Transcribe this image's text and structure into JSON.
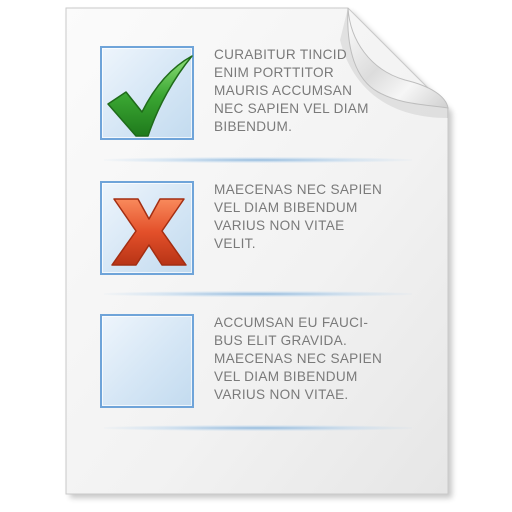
{
  "items": [
    {
      "state": "checked",
      "icon": "green-checkmark-icon",
      "mark_color": "#3aa632",
      "lines": [
        "CURABITUR TINCID",
        "ENIM PORTTITOR",
        "MAURIS ACCUMSAN",
        "NEC SAPIEN VEL DIAM",
        "BIBENDUM."
      ]
    },
    {
      "state": "crossed",
      "icon": "red-x-icon",
      "mark_color": "#e3502a",
      "lines": [
        "MAECENAS NEC SAPIEN",
        "VEL DIAM BIBENDUM",
        "VARIUS NON VITAE",
        "VELIT."
      ]
    },
    {
      "state": "empty",
      "icon": "",
      "mark_color": "",
      "lines": [
        "ACCUMSAN EU FAUCI-",
        "BUS ELIT GRAVIDA.",
        "MAECENAS NEC SAPIEN",
        "VEL DIAM BIBENDUM",
        "VARIUS NON VITAE."
      ]
    }
  ],
  "colors": {
    "box_border": "#6fa4d9",
    "text": "#7a7a7a",
    "separator": "#8ab8e0"
  }
}
